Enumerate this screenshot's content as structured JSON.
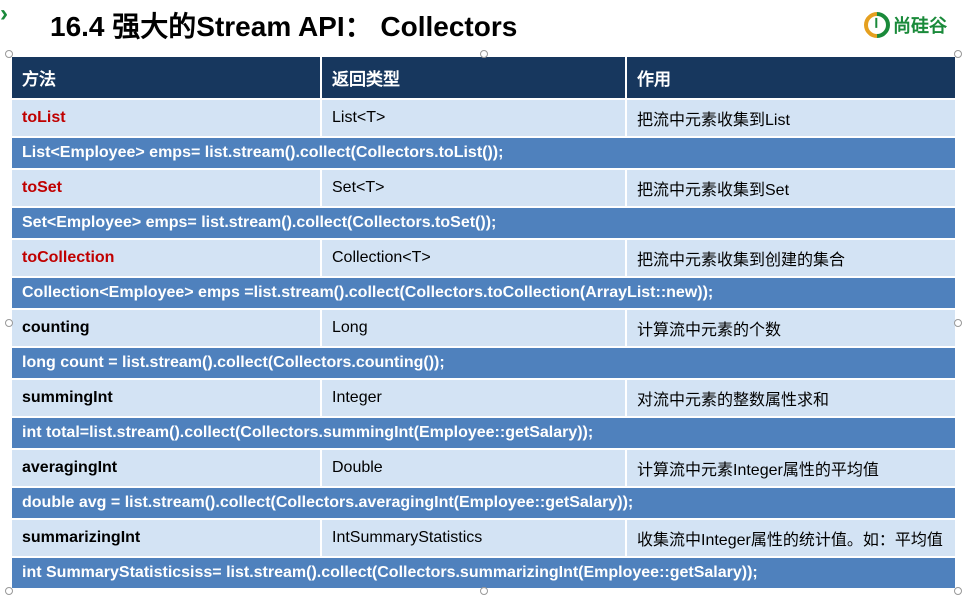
{
  "header": {
    "title": "16.4 强大的Stream API： Collectors",
    "logo_text": "尚硅谷"
  },
  "table": {
    "headers": {
      "method": "方法",
      "return_type": "返回类型",
      "purpose": "作用"
    },
    "rows": [
      {
        "method": "toList",
        "method_style": "red",
        "return_type": "List<T>",
        "purpose": "把流中元素收集到List"
      },
      {
        "code": "List<Employee> emps= list.stream().collect(Collectors.toList());"
      },
      {
        "method": "toSet",
        "method_style": "red",
        "return_type": "Set<T>",
        "purpose": "把流中元素收集到Set"
      },
      {
        "code": "Set<Employee> emps= list.stream().collect(Collectors.toSet());"
      },
      {
        "method": "toCollection",
        "method_style": "red",
        "return_type": "Collection<T>",
        "purpose": "把流中元素收集到创建的集合"
      },
      {
        "code": "Collection<Employee> emps =list.stream().collect(Collectors.toCollection(ArrayList::new));"
      },
      {
        "method": "counting",
        "method_style": "black",
        "return_type": "Long",
        "purpose": "计算流中元素的个数"
      },
      {
        "code": "long count = list.stream().collect(Collectors.counting());"
      },
      {
        "method": "summingInt",
        "method_style": "black",
        "return_type": "Integer",
        "purpose": "对流中元素的整数属性求和"
      },
      {
        "code": "int total=list.stream().collect(Collectors.summingInt(Employee::getSalary));"
      },
      {
        "method": "averagingInt",
        "method_style": "black",
        "return_type": "Double",
        "purpose": "计算流中元素Integer属性的平均值"
      },
      {
        "code": "double avg = list.stream().collect(Collectors.averagingInt(Employee::getSalary));"
      },
      {
        "method": "summarizingInt",
        "method_style": "black",
        "return_type": "IntSummaryStatistics",
        "purpose": "收集流中Integer属性的统计值。如：平均值"
      },
      {
        "code": "int SummaryStatisticsiss= list.stream().collect(Collectors.summarizingInt(Employee::getSalary));"
      }
    ]
  }
}
